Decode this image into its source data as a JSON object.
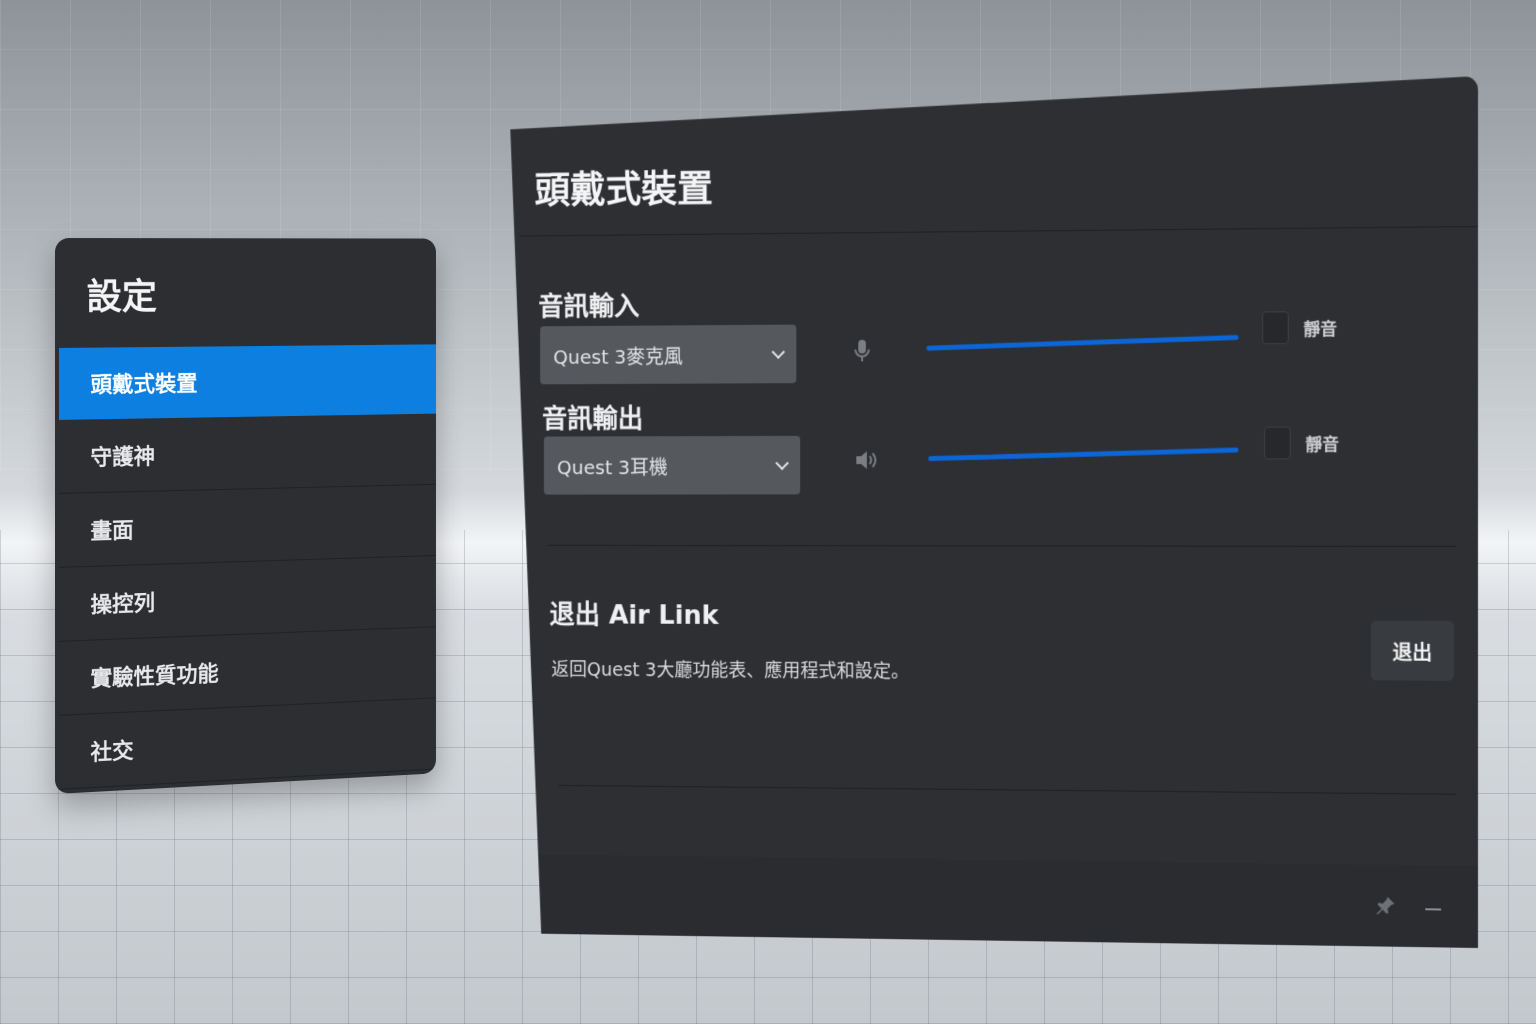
{
  "sidebar": {
    "title": "設定",
    "items": [
      {
        "label": "頭戴式裝置",
        "active": true
      },
      {
        "label": "守護神",
        "active": false
      },
      {
        "label": "畫面",
        "active": false
      },
      {
        "label": "操控列",
        "active": false
      },
      {
        "label": "實驗性質功能",
        "active": false
      },
      {
        "label": "社交",
        "active": false
      }
    ]
  },
  "main": {
    "title": "頭戴式裝置",
    "audio_input": {
      "label": "音訊輸入",
      "device": "Quest 3麥克風",
      "icon": "microphone-icon",
      "volume": 1.0,
      "mute_label": "靜音",
      "muted": false
    },
    "audio_output": {
      "label": "音訊輸出",
      "device": "Quest 3耳機",
      "icon": "speaker-icon",
      "volume": 1.0,
      "mute_label": "靜音",
      "muted": false
    },
    "air_link": {
      "title": "退出 Air Link",
      "description": "返回Quest 3大廳功能表、應用程式和設定。",
      "button_label": "退出"
    },
    "footer_icons": [
      "pin-icon",
      "minimize-icon"
    ]
  },
  "colors": {
    "accent": "#0d7fe0",
    "slider": "#0c66d8",
    "panel": "#2d2f32"
  }
}
